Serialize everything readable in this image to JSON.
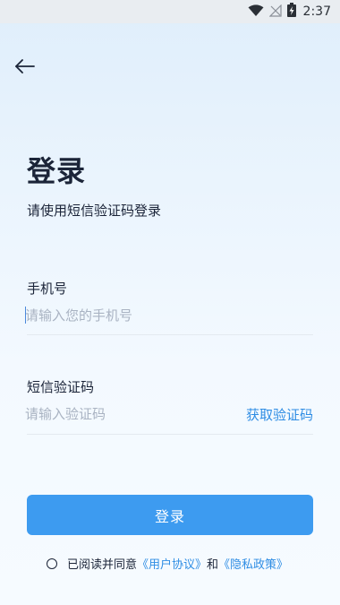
{
  "status_bar": {
    "time": "2:37",
    "icons": [
      "wifi-icon",
      "signal-off-icon",
      "battery-charging-icon"
    ]
  },
  "header": {
    "back_icon": "arrow-left-icon"
  },
  "page": {
    "title": "登录",
    "subtitle": "请使用短信验证码登录"
  },
  "form": {
    "phone": {
      "label": "手机号",
      "placeholder": "请输入您的手机号",
      "value": ""
    },
    "code": {
      "label": "短信验证码",
      "placeholder": "请输入验证码",
      "value": "",
      "get_code_label": "获取验证码"
    },
    "submit_label": "登录"
  },
  "agreement": {
    "prefix": "已阅读并同意",
    "user_agreement": "《用户协议》",
    "conjunction": "和",
    "privacy_policy": "《隐私政策》",
    "checked": false
  },
  "colors": {
    "accent": "#3d9bf0",
    "link": "#2f8de4",
    "text": "#1b2438",
    "placeholder": "#a9b3c2"
  }
}
